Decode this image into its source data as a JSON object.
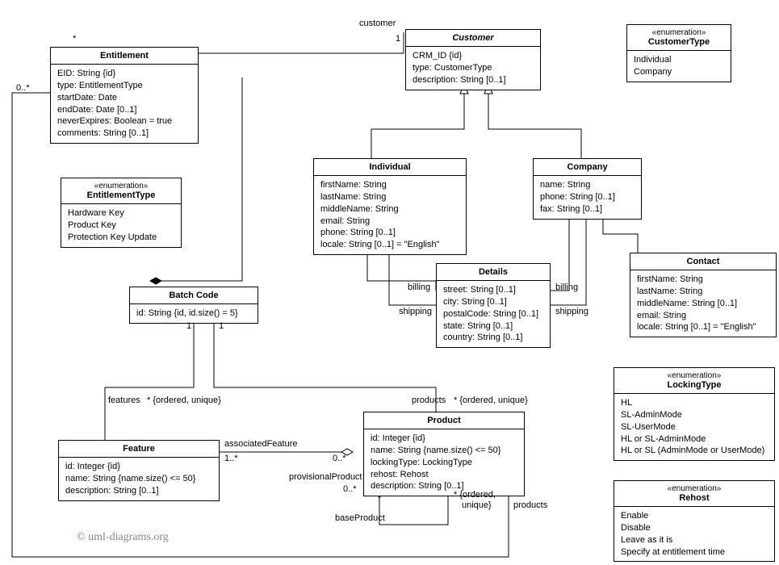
{
  "classes": {
    "entitlement": {
      "title": "Entitlement",
      "attrs": [
        "EID: String {id}",
        "type: EntitlementType",
        "startDate: Date",
        "endDate: Date [0..1]",
        "neverExpires: Boolean = true",
        "comments: String [0..1]"
      ]
    },
    "entitlementType": {
      "stereotype": "«enumeration»",
      "title": "EntitlementType",
      "attrs": [
        "Hardware Key",
        "Product Key",
        "Protection Key Update"
      ]
    },
    "customer": {
      "title": "Customer",
      "attrs": [
        "CRM_ID {id}",
        "type: CustomerType",
        "description: String [0..1]"
      ]
    },
    "customerType": {
      "stereotype": "«enumeration»",
      "title": "CustomerType",
      "attrs": [
        "Individual",
        "Company"
      ]
    },
    "individual": {
      "title": "Individual",
      "attrs": [
        "firstName: String",
        "lastName: String",
        "middleName: String",
        "email: String",
        "phone: String [0..1]",
        "locale: String [0..1] = \"English\""
      ]
    },
    "company": {
      "title": "Company",
      "attrs": [
        "name: String",
        "phone: String [0..1]",
        "fax: String [0..1]"
      ]
    },
    "details": {
      "title": "Details",
      "attrs": [
        "street: String [0..1]",
        "city: String [0..1]",
        "postalCode: String [0..1]",
        "state: String [0..1]",
        "country: String [0..1]"
      ]
    },
    "contact": {
      "title": "Contact",
      "attrs": [
        "firstName: String",
        "lastName: String",
        "middleName: String [0..1]",
        "email: String",
        "locale: String [0..1] = \"English\""
      ]
    },
    "batchCode": {
      "title": "Batch Code",
      "attrs": [
        "id: String {id, id.size() = 5}"
      ]
    },
    "feature": {
      "title": "Feature",
      "attrs": [
        "id: Integer {id}",
        "name: String {name.size() <= 50}",
        "description: String [0..1]"
      ]
    },
    "product": {
      "title": "Product",
      "attrs": [
        "id: Integer {id}",
        "name: String {name.size() <= 50}",
        "lockingType: LockingType",
        "rehost: Rehost",
        "description: String [0..1]"
      ]
    },
    "lockingType": {
      "stereotype": "«enumeration»",
      "title": "LockingType",
      "attrs": [
        "HL",
        "SL-AdminMode",
        "SL-UserMode",
        "HL or SL-AdminMode",
        "HL or SL (AdminMode or UserMode)"
      ]
    },
    "rehost": {
      "stereotype": "«enumeration»",
      "title": "Rehost",
      "attrs": [
        "Enable",
        "Disable",
        "Leave as it is",
        "Specify at entitlement time"
      ]
    }
  },
  "labels": {
    "customerRole": "customer",
    "customerMult": "1",
    "entStar": "*",
    "entZeroMany": "0..*",
    "billing1": "billing",
    "shipping1": "shipping",
    "billing2": "billing",
    "shipping2": "shipping",
    "batchOne1": "1",
    "batchOne2": "1",
    "features": "features",
    "featuresConstraint": "* {ordered, unique}",
    "products": "products",
    "productsConstraint": "* {ordered, unique}",
    "associatedFeature": "associatedFeature",
    "assocFeatMult": "1..*",
    "assocProdMult": "0..*",
    "provisionalProduct": "provisionalProduct",
    "provisionalMult": "0..*",
    "baseProduct": "baseProduct",
    "selfProducts": "products",
    "selfConstraint1": "* {ordered,",
    "selfConstraint2": "unique}"
  },
  "watermark": "© uml-diagrams.org"
}
